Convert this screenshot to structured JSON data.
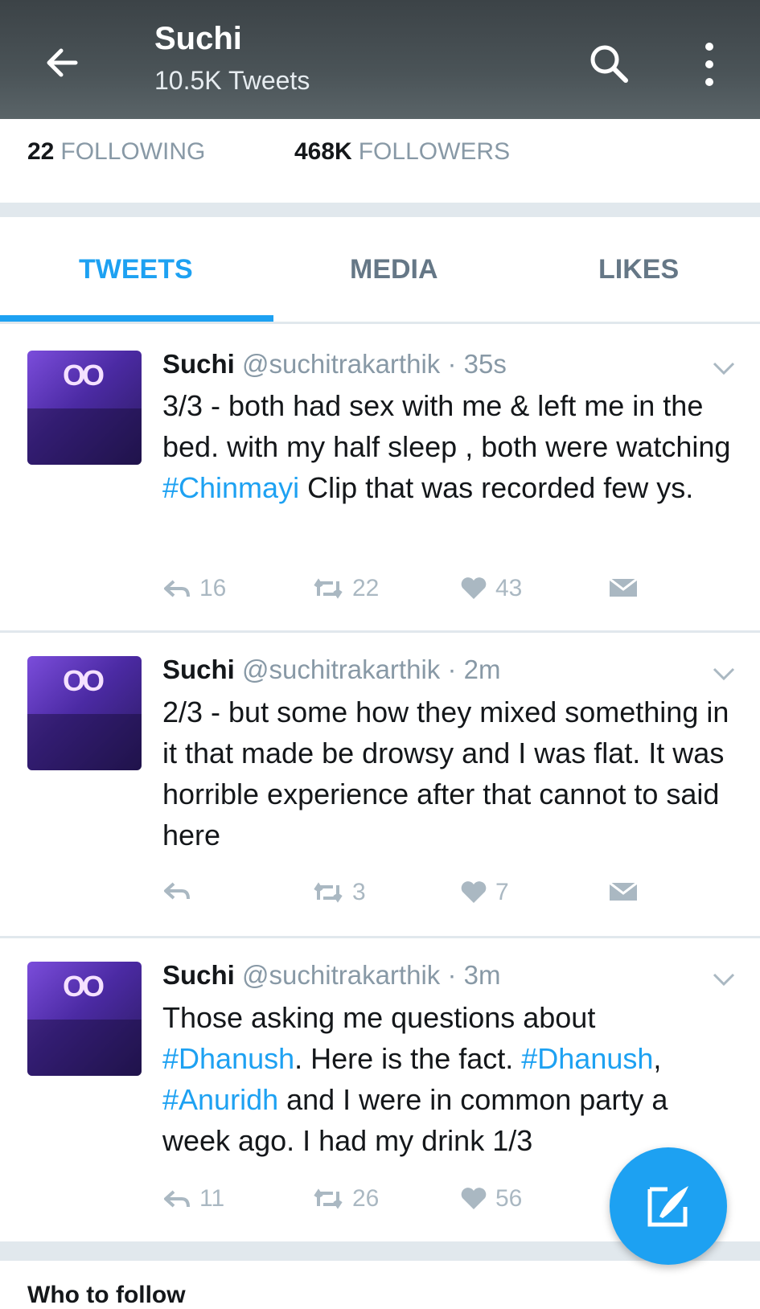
{
  "header": {
    "back_icon": "arrow-left-icon",
    "title": "Suchi",
    "subtitle": "10.5K Tweets",
    "search_icon": "search-icon",
    "more_icon": "more-vertical-icon"
  },
  "stats": {
    "following_count": "22",
    "following_label": "FOLLOWING",
    "followers_count": "468K",
    "followers_label": "FOLLOWERS"
  },
  "tabs": [
    {
      "label": "TWEETS",
      "active": true
    },
    {
      "label": "MEDIA",
      "active": false
    },
    {
      "label": "LIKES",
      "active": false
    }
  ],
  "tweets": [
    {
      "name": "Suchi",
      "handle": "@suchitrakarthik",
      "time": "· 35s",
      "parts": [
        "3/3 - both had sex with me & left me in the bed. with my half sleep , both were watching ",
        "#Chinmayi",
        " Clip that was recorded few ys."
      ],
      "replies": "16",
      "retweets": "22",
      "likes": "43"
    },
    {
      "name": "Suchi",
      "handle": "@suchitrakarthik",
      "time": "· 2m",
      "parts": [
        "2/3 - but some how they mixed something in it that made be drowsy and I was flat. It was horrible experience after that cannot to said here"
      ],
      "replies": "",
      "retweets": "3",
      "likes": "7"
    },
    {
      "name": "Suchi",
      "handle": "@suchitrakarthik",
      "time": "· 3m",
      "parts": [
        "Those asking me questions about ",
        "#Dhanush",
        ". Here is the fact. ",
        "#Dhanush",
        ", ",
        "#Anuridh",
        " and I were in common party a week ago. I had my drink 1/3"
      ],
      "replies": "11",
      "retweets": "26",
      "likes": "56"
    }
  ],
  "fab": {
    "icon": "compose-tweet-icon"
  },
  "footer": {
    "partial_text": "Who to follow"
  },
  "colors": {
    "accent": "#1da1f2",
    "muted": "#8899a6",
    "action": "#aab8c2"
  }
}
